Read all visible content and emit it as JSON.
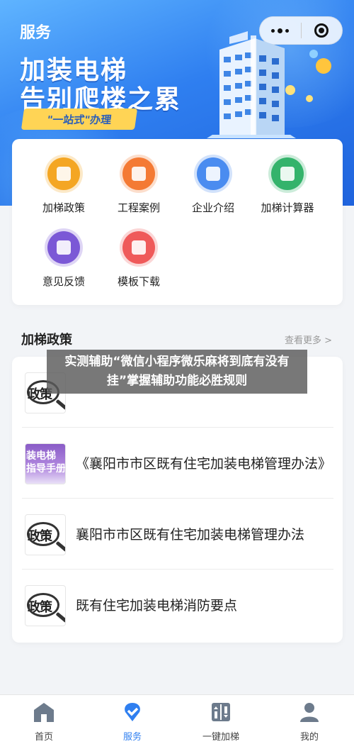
{
  "header": {
    "title": "服务",
    "capsule": {
      "more_icon": "more-dots-icon",
      "close_icon": "close-target-icon"
    }
  },
  "banner": {
    "headline_line1": "加装电梯",
    "headline_line2": "告别爬楼之累",
    "tag": "\"一站式\"办理"
  },
  "services": [
    {
      "label": "加梯政策",
      "icon": "policy-icon",
      "color": "#f5a623"
    },
    {
      "label": "工程案例",
      "icon": "case-icon",
      "color": "#f47a35"
    },
    {
      "label": "企业介绍",
      "icon": "company-icon",
      "color": "#4a8cf0"
    },
    {
      "label": "加梯计算器",
      "icon": "calculator-icon",
      "color": "#34b36b"
    },
    {
      "label": "意见反馈",
      "icon": "feedback-icon",
      "color": "#7b59d6"
    },
    {
      "label": "模板下载",
      "icon": "download-icon",
      "color": "#ef5a5a"
    }
  ],
  "policy": {
    "section_title": "加梯政策",
    "more_label": "查看更多 >",
    "items": [
      {
        "title": "",
        "thumb_text": "政策"
      },
      {
        "title": "《襄阳市市区既有住宅加装电梯管理办法》",
        "thumb_text_1": "装电梯",
        "thumb_text_2": "指导手册"
      },
      {
        "title": "襄阳市市区既有住宅加装电梯管理办法",
        "thumb_text": "政策"
      },
      {
        "title": "既有住宅加装电梯消防要点",
        "thumb_text": "政策"
      }
    ]
  },
  "overlay": {
    "text": "实测辅助“微信小程序微乐麻将到底有没有挂”掌握辅助功能必胜规则"
  },
  "tabbar": [
    {
      "label": "首页",
      "icon": "home-icon",
      "active": false
    },
    {
      "label": "服务",
      "icon": "service-icon",
      "active": true
    },
    {
      "label": "一键加梯",
      "icon": "elevator-icon",
      "active": false
    },
    {
      "label": "我的",
      "icon": "user-icon",
      "active": false
    }
  ]
}
